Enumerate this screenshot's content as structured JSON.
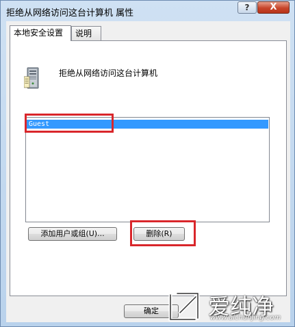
{
  "window": {
    "title": "拒绝从网络访问这台计算机 属性",
    "help_label": "?",
    "close_label": "X"
  },
  "tabs": [
    {
      "label": "本地安全设置",
      "active": true
    },
    {
      "label": "说明",
      "active": false
    }
  ],
  "policy": {
    "title": "拒绝从网络访问这台计算机",
    "icon": "server-computer-icon"
  },
  "list": {
    "items": [
      {
        "label": "Guest",
        "selected": true
      }
    ]
  },
  "buttons": {
    "add_label": "添加用户或组(U)...",
    "remove_label": "删除(R)",
    "ok_label": "确定"
  },
  "watermark": {
    "brand": "爱纯净",
    "url": "www.aichunjing.com"
  },
  "colors": {
    "selection": "#3399ff",
    "highlight": "#d9262b",
    "title_bar": "#cfe1f3"
  }
}
